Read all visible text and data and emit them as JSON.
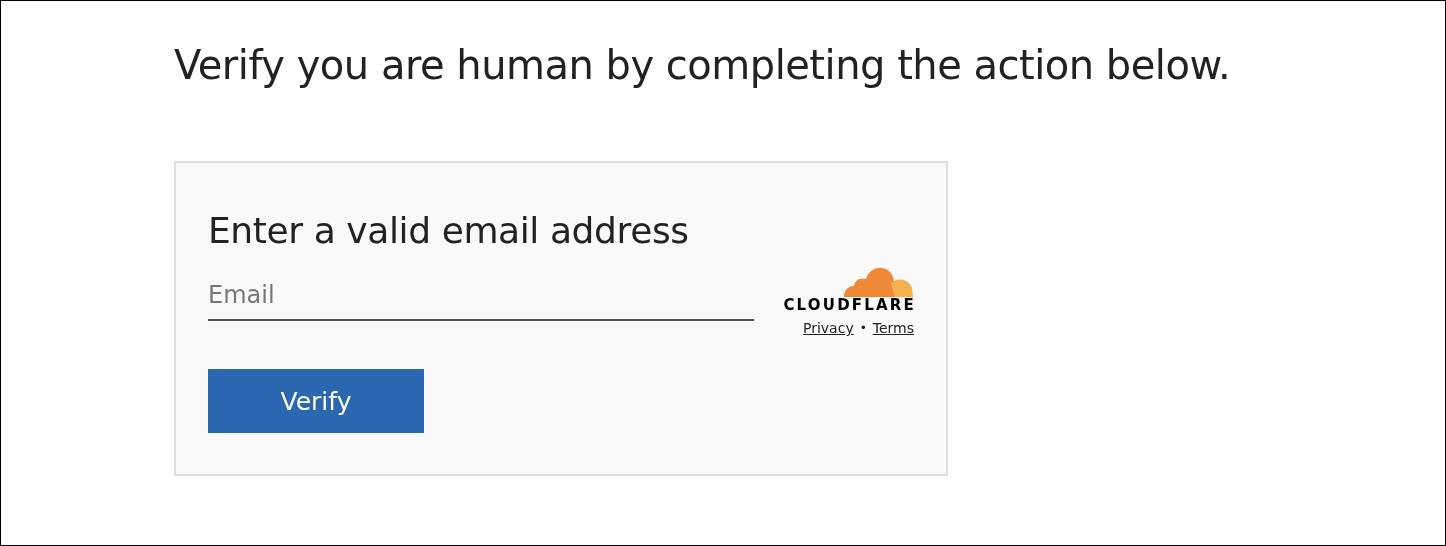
{
  "heading": "Verify you are human by completing the action below.",
  "card": {
    "title": "Enter a valid email address",
    "email_field": {
      "placeholder": "Email"
    },
    "button": "Verify",
    "brand": {
      "wordmark": "CLOUDFLARE",
      "links": [
        "Privacy",
        "Terms"
      ],
      "separator": "•"
    }
  }
}
